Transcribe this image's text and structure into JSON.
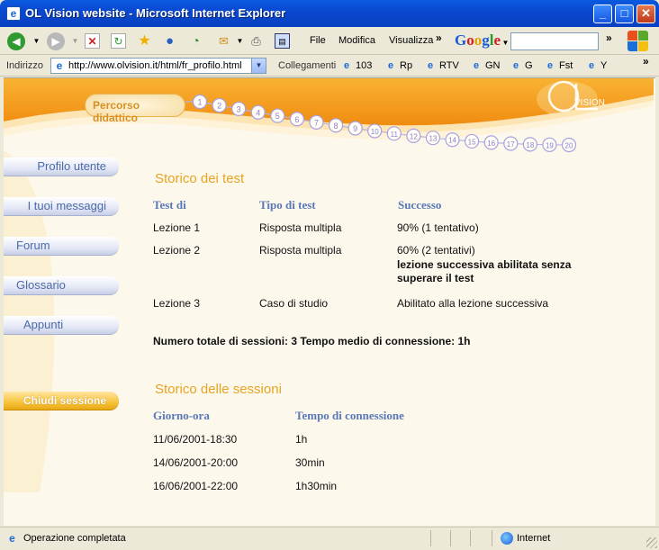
{
  "window": {
    "title": "OL Vision website - Microsoft Internet Explorer"
  },
  "toolbar": {
    "menus": [
      "File",
      "Modifica",
      "Visualizza"
    ],
    "search_brand": "Google",
    "overflow": "»"
  },
  "addressbar": {
    "label": "Indirizzo",
    "url": "http://www.olvision.it/html/fr_profilo.html",
    "links_label": "Collegamenti",
    "links": [
      "103",
      "Rp",
      "RTV",
      "GN",
      "G",
      "Fst",
      "Y"
    ]
  },
  "banner": {
    "course_label": "Percorso didattico",
    "steps": [
      "1",
      "2",
      "3",
      "4",
      "5",
      "6",
      "7",
      "8",
      "9",
      "10",
      "11",
      "12",
      "13",
      "14",
      "15",
      "16",
      "17",
      "18",
      "19",
      "20"
    ],
    "logo_text": "VISION"
  },
  "nav": {
    "items": [
      "Profilo utente",
      "I tuoi messaggi",
      "Forum",
      "Glossario",
      "Appunti"
    ],
    "logout": "Chiudi sessione"
  },
  "tests": {
    "title": "Storico dei test",
    "headers": [
      "Test di",
      "Tipo di test",
      "Successo"
    ],
    "rows": [
      {
        "lesson": "Lezione 1",
        "type": "Risposta multipla",
        "result": "90% (1 tentativo)",
        "note": ""
      },
      {
        "lesson": "Lezione 2",
        "type": "Risposta multipla",
        "result": "60% (2 tentativi)",
        "note": "lezione successiva abilitata senza superare il test"
      },
      {
        "lesson": "Lezione 3",
        "type": "Caso di studio",
        "result": "Abilitato alla lezione successiva",
        "note": ""
      }
    ],
    "summary": "Numero totale di sessioni: 3 Tempo medio di connessione: 1h"
  },
  "sessions": {
    "title": "Storico delle sessioni",
    "headers": [
      "Giorno-ora",
      "Tempo di connessione"
    ],
    "rows": [
      {
        "datetime": "11/06/2001-18:30",
        "duration": "1h"
      },
      {
        "datetime": "14/06/2001-20:00",
        "duration": "30min"
      },
      {
        "datetime": "16/06/2001-22:00",
        "duration": "1h30min"
      }
    ]
  },
  "statusbar": {
    "text": "Operazione completata",
    "zone": "Internet"
  },
  "colors": {
    "accent_orange": "#f0a020",
    "header_blue": "#5878b8",
    "page_bg": "#fdf8ec",
    "title_blue": "#0a48d0"
  }
}
